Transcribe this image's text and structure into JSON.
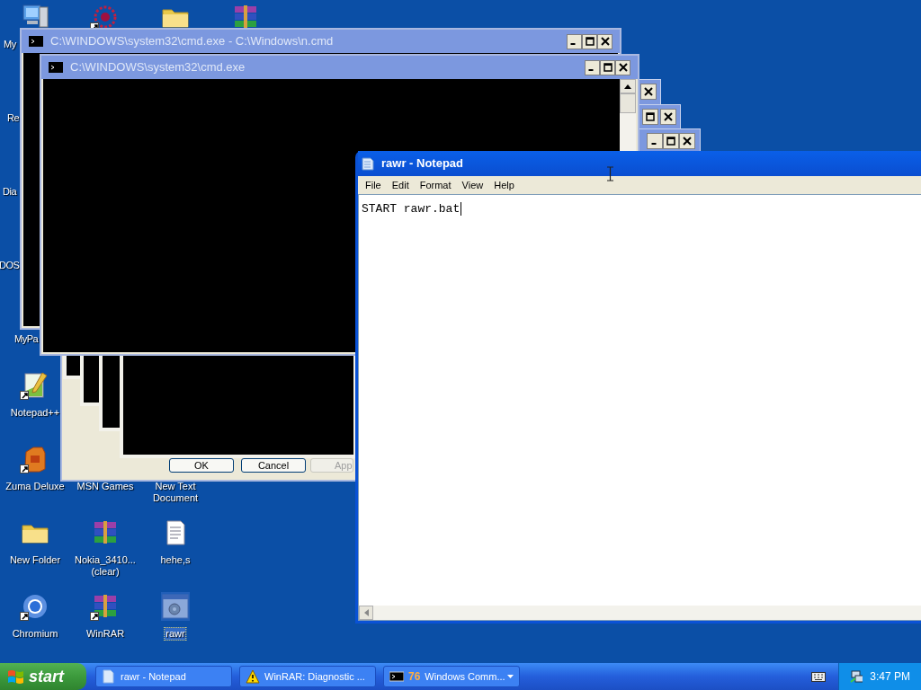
{
  "desktop_icons": [
    {
      "kind": "computer",
      "label": "My",
      "shortcut": false,
      "selected": false
    },
    {
      "kind": "flower",
      "shortcut": true,
      "selected": false
    },
    {
      "kind": "folder",
      "shortcut": false,
      "selected": false
    },
    {
      "kind": "archive",
      "shortcut": false,
      "selected": false
    },
    {
      "label": "Re",
      "selected": false
    },
    {
      "label": "Dia",
      "selected": false
    },
    {
      "label": "DOS",
      "selected": false
    },
    {
      "label": "MyPa",
      "selected": false
    },
    {
      "kind": "notepadpp",
      "label": "Notepad++",
      "shortcut": true,
      "selected": false
    },
    {
      "kind": "zuma",
      "label": "Zuma Deluxe",
      "shortcut": true,
      "selected": false
    },
    {
      "label": "MSN Games",
      "selected": false
    },
    {
      "label": "New Text Document",
      "selected": false
    },
    {
      "kind": "folder",
      "label": "New Folder",
      "shortcut": false,
      "selected": false
    },
    {
      "kind": "archive",
      "label": "Nokia_3410... (clear)",
      "shortcut": false,
      "selected": false
    },
    {
      "kind": "textfile",
      "label": "hehe,s",
      "shortcut": false,
      "selected": false
    },
    {
      "kind": "chromium",
      "label": "Chromium",
      "shortcut": true,
      "selected": false
    },
    {
      "kind": "archive",
      "label": "WinRAR",
      "shortcut": true,
      "selected": false
    },
    {
      "kind": "script",
      "label": "rawr",
      "shortcut": false,
      "selected": true
    }
  ],
  "console_windows": [
    {
      "title": "C:\\WINDOWS\\system32\\cmd.exe - C:\\Windows\\n.cmd",
      "active": false
    },
    {
      "title": "C:\\WINDOWS\\system32\\cmd.exe",
      "active": false
    }
  ],
  "dialog": {
    "buttons": [
      {
        "label": "OK",
        "disabled": false
      },
      {
        "label": "Cancel",
        "disabled": false
      },
      {
        "label": "App",
        "disabled": true
      }
    ]
  },
  "notepad": {
    "title": "rawr - Notepad",
    "active": true,
    "menu": [
      "File",
      "Edit",
      "Format",
      "View",
      "Help"
    ],
    "text": "START rawr.bat"
  },
  "taskbar": {
    "start": "start",
    "tasks": [
      {
        "kind": "notepad",
        "label": "rawr - Notepad"
      },
      {
        "kind": "warning",
        "label": "WinRAR: Diagnostic ..."
      },
      {
        "kind": "console",
        "count": "76",
        "label": "Windows Comm...",
        "grouped": true
      }
    ],
    "clock": "3:47 PM"
  }
}
